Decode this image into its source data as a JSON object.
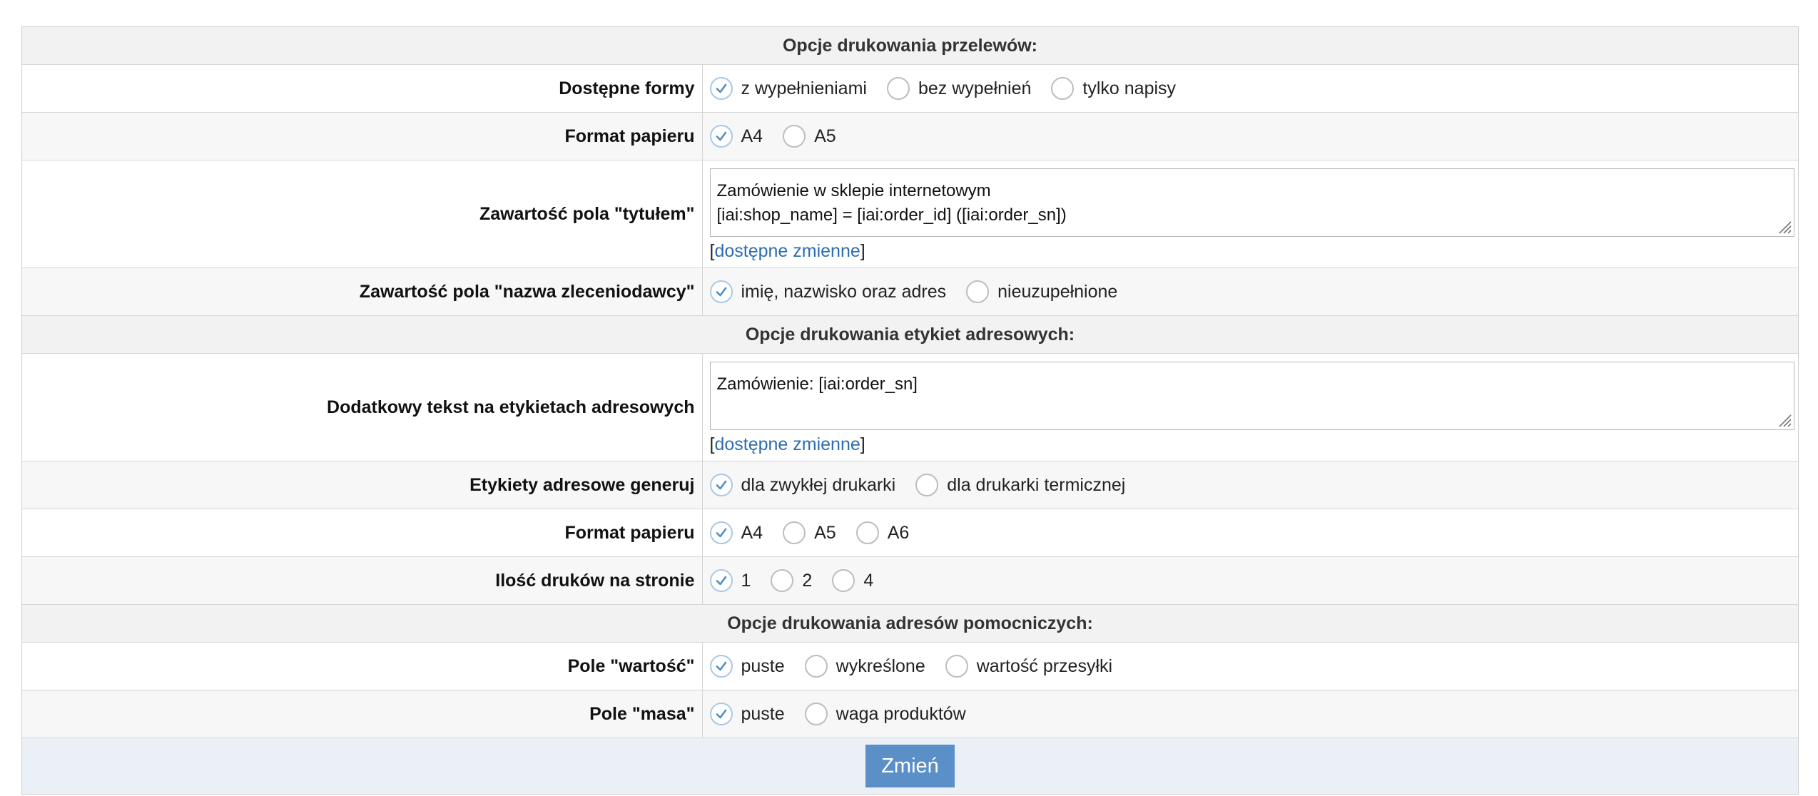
{
  "sections": {
    "transfers": "Opcje drukowania przelewów:",
    "labels": "Opcje drukowania etykiet adresowych:",
    "aux": "Opcje drukowania adresów pomocniczych:"
  },
  "transfers": {
    "forms": {
      "label": "Dostępne formy",
      "options": [
        "z wypełnieniami",
        "bez wypełnień",
        "tylko napisy"
      ],
      "selected": "z wypełnieniami"
    },
    "paper": {
      "label": "Format papieru",
      "options": [
        "A4",
        "A5"
      ],
      "selected": "A4"
    },
    "title_field": {
      "label": "Zawartość pola \"tytułem\"",
      "value_line1": "Zamówienie w sklepie internetowym",
      "value_line2": "[iai:shop_name] = [iai:order_id] ([iai:order_sn])",
      "vars_open": "[",
      "vars_link": "dostępne zmienne",
      "vars_close": "]"
    },
    "payer": {
      "label": "Zawartość pola \"nazwa zleceniodawcy\"",
      "options": [
        "imię, nazwisko oraz adres",
        "nieuzupełnione"
      ],
      "selected": "imię, nazwisko oraz adres"
    }
  },
  "labels": {
    "extra_text": {
      "label": "Dodatkowy tekst na etykietach adresowych",
      "value": "Zamówienie: [iai:order_sn]",
      "vars_open": "[",
      "vars_link": "dostępne zmienne",
      "vars_close": "]"
    },
    "generate": {
      "label": "Etykiety adresowe generuj",
      "options": [
        "dla zwykłej drukarki",
        "dla drukarki termicznej"
      ],
      "selected": "dla zwykłej drukarki"
    },
    "paper": {
      "label": "Format papieru",
      "options": [
        "A4",
        "A5",
        "A6"
      ],
      "selected": "A4"
    },
    "per_page": {
      "label": "Ilość druków na stronie",
      "options": [
        "1",
        "2",
        "4"
      ],
      "selected": "1"
    }
  },
  "aux": {
    "value_field": {
      "label": "Pole \"wartość\"",
      "options": [
        "puste",
        "wykreślone",
        "wartość przesyłki"
      ],
      "selected": "puste"
    },
    "mass_field": {
      "label": "Pole \"masa\"",
      "options": [
        "puste",
        "waga produktów"
      ],
      "selected": "puste"
    }
  },
  "submit_label": "Zmień",
  "colors": {
    "accent": "#5b8fc7",
    "check": "#4a90c8",
    "link": "#2c6db3"
  },
  "icons": {
    "checked": "checkmark-icon",
    "resize": "resize-grip-icon"
  }
}
